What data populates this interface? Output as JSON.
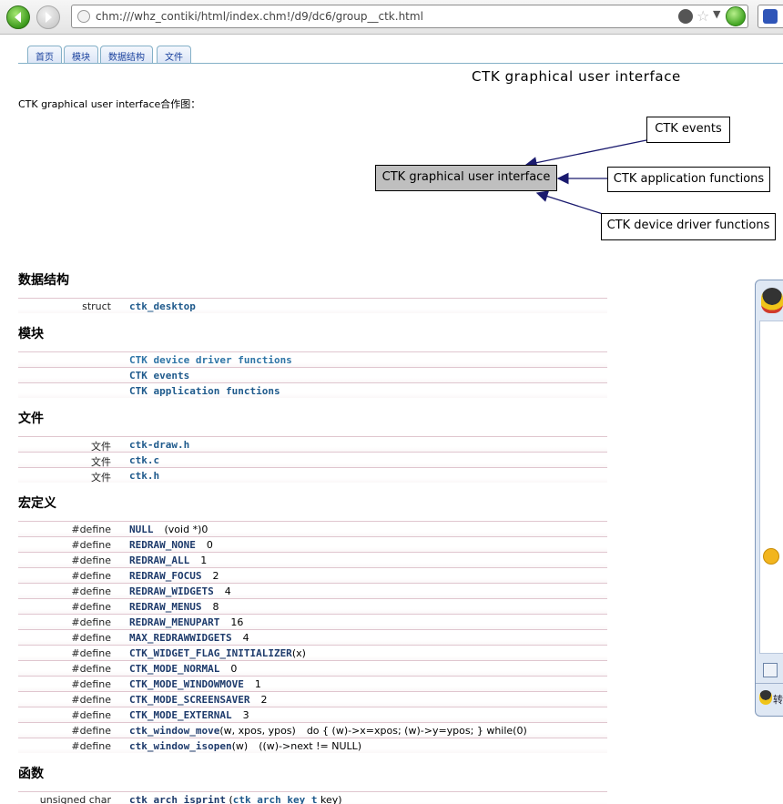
{
  "browser": {
    "url": "chm:///whz_contiki/html/index.chm!/d9/dc6/group__ctk.html"
  },
  "tabs": [
    "首页",
    "模块",
    "数据结构",
    "文件"
  ],
  "page": {
    "title": "CTK graphical user interface",
    "collab_label": "CTK graphical user interface合作图："
  },
  "graph": {
    "center": "CTK graphical user interface",
    "events": "CTK events",
    "app_functions": "CTK application functions",
    "device_driver": "CTK device driver functions"
  },
  "sections": {
    "data_structures": {
      "heading": "数据结构",
      "rows": [
        {
          "type": "struct",
          "name": "ctk_desktop"
        }
      ]
    },
    "modules": {
      "heading": "模块",
      "rows": [
        {
          "name": "CTK device driver functions"
        },
        {
          "name": "CTK events"
        },
        {
          "name": "CTK application functions"
        }
      ]
    },
    "files": {
      "heading": "文件",
      "rows": [
        {
          "type": "文件",
          "name": "ctk-draw.h"
        },
        {
          "type": "文件",
          "name": "ctk.c"
        },
        {
          "type": "文件",
          "name": "ctk.h"
        }
      ]
    },
    "macros": {
      "heading": "宏定义",
      "rows": [
        {
          "type": "#define",
          "name": "NULL",
          "value": "(void *)0"
        },
        {
          "type": "#define",
          "name": "REDRAW_NONE",
          "value": "0"
        },
        {
          "type": "#define",
          "name": "REDRAW_ALL",
          "value": "1"
        },
        {
          "type": "#define",
          "name": "REDRAW_FOCUS",
          "value": "2"
        },
        {
          "type": "#define",
          "name": "REDRAW_WIDGETS",
          "value": "4"
        },
        {
          "type": "#define",
          "name": "REDRAW_MENUS",
          "value": "8"
        },
        {
          "type": "#define",
          "name": "REDRAW_MENUPART",
          "value": "16"
        },
        {
          "type": "#define",
          "name": "MAX_REDRAWWIDGETS",
          "value": "4"
        },
        {
          "type": "#define",
          "name": "CTK_WIDGET_FLAG_INITIALIZER",
          "args": "(x)",
          "value": ""
        },
        {
          "type": "#define",
          "name": "CTK_MODE_NORMAL",
          "value": "0"
        },
        {
          "type": "#define",
          "name": "CTK_MODE_WINDOWMOVE",
          "value": "1"
        },
        {
          "type": "#define",
          "name": "CTK_MODE_SCREENSAVER",
          "value": "2"
        },
        {
          "type": "#define",
          "name": "CTK_MODE_EXTERNAL",
          "value": "3"
        },
        {
          "type": "#define",
          "name": "ctk_window_move",
          "args": "(w, xpos, ypos)",
          "value": "do { (w)->x=xpos; (w)->y=ypos; } while(0)"
        },
        {
          "type": "#define",
          "name": "ctk_window_isopen",
          "args": "(w)",
          "value": "((w)->next != NULL)"
        }
      ]
    },
    "functions": {
      "heading": "函数",
      "rows": [
        {
          "type": "unsigned char",
          "name": "ctk_arch_isprint",
          "args_open": "(",
          "arg_type": "ctk_arch_key_t",
          "args_rest": " key)"
        }
      ]
    }
  },
  "im_panel": {
    "text": "转"
  }
}
